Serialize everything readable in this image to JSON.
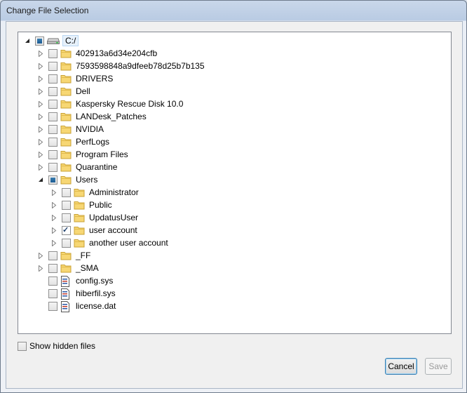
{
  "window": {
    "title": "Change File Selection"
  },
  "tree": {
    "root": {
      "label": "C:/",
      "state": "partial",
      "expanded": true,
      "icon": "drive-icon"
    },
    "items": [
      {
        "label": "402913a6d34e204cfb",
        "type": "folder",
        "state": "unchecked",
        "expanded": false,
        "depth": 1
      },
      {
        "label": "7593598848a9dfeeb78d25b7b135",
        "type": "folder",
        "state": "unchecked",
        "expanded": false,
        "depth": 1
      },
      {
        "label": "DRIVERS",
        "type": "folder",
        "state": "unchecked",
        "expanded": false,
        "depth": 1
      },
      {
        "label": "Dell",
        "type": "folder",
        "state": "unchecked",
        "expanded": false,
        "depth": 1
      },
      {
        "label": "Kaspersky Rescue Disk 10.0",
        "type": "folder",
        "state": "unchecked",
        "expanded": false,
        "depth": 1
      },
      {
        "label": "LANDesk_Patches",
        "type": "folder",
        "state": "unchecked",
        "expanded": false,
        "depth": 1
      },
      {
        "label": "NVIDIA",
        "type": "folder",
        "state": "unchecked",
        "expanded": false,
        "depth": 1
      },
      {
        "label": "PerfLogs",
        "type": "folder",
        "state": "unchecked",
        "expanded": false,
        "depth": 1
      },
      {
        "label": "Program Files",
        "type": "folder",
        "state": "unchecked",
        "expanded": false,
        "depth": 1
      },
      {
        "label": "Quarantine",
        "type": "folder",
        "state": "unchecked",
        "expanded": false,
        "depth": 1
      },
      {
        "label": "Users",
        "type": "folder",
        "state": "partial",
        "expanded": true,
        "depth": 1
      },
      {
        "label": "Administrator",
        "type": "folder",
        "state": "unchecked",
        "expanded": false,
        "depth": 2
      },
      {
        "label": "Public",
        "type": "folder",
        "state": "unchecked",
        "expanded": false,
        "depth": 2
      },
      {
        "label": "UpdatusUser",
        "type": "folder",
        "state": "unchecked",
        "expanded": false,
        "depth": 2
      },
      {
        "label": "user account",
        "type": "folder",
        "state": "checked",
        "expanded": false,
        "depth": 2
      },
      {
        "label": "another user account",
        "type": "folder",
        "state": "unchecked",
        "expanded": false,
        "depth": 2
      },
      {
        "label": "_FF",
        "type": "folder",
        "state": "unchecked",
        "expanded": false,
        "depth": 1
      },
      {
        "label": "_SMA",
        "type": "folder",
        "state": "unchecked",
        "expanded": false,
        "depth": 1
      },
      {
        "label": "config.sys",
        "type": "file",
        "state": "unchecked",
        "depth": 1
      },
      {
        "label": "hiberfil.sys",
        "type": "file",
        "state": "unchecked",
        "depth": 1
      },
      {
        "label": "license.dat",
        "type": "file",
        "state": "unchecked",
        "depth": 1
      }
    ]
  },
  "options": {
    "show_hidden_label": "Show hidden files",
    "show_hidden_checked": false
  },
  "buttons": {
    "cancel_label": "Cancel",
    "save_label": "Save",
    "save_enabled": false
  }
}
